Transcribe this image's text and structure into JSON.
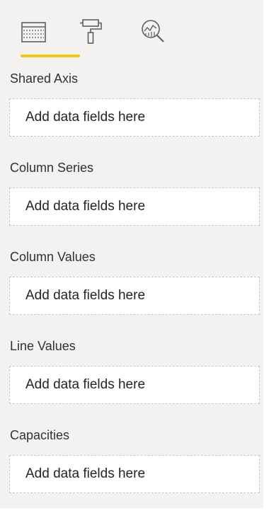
{
  "tabs": [
    {
      "id": "fields",
      "icon": "fields-table-icon",
      "active": true
    },
    {
      "id": "format",
      "icon": "paint-roller-icon",
      "active": false
    },
    {
      "id": "analytics",
      "icon": "analytics-magnifier-icon",
      "active": false
    }
  ],
  "colors": {
    "accent": "#f2c811",
    "pane_background": "#f3f2f1",
    "drop_zone_border": "#c8c6c4",
    "icon": "#605e5c"
  },
  "wells": [
    {
      "label": "Shared Axis",
      "placeholder": "Add data fields here"
    },
    {
      "label": "Column Series",
      "placeholder": "Add data fields here"
    },
    {
      "label": "Column Values",
      "placeholder": "Add data fields here"
    },
    {
      "label": "Line Values",
      "placeholder": "Add data fields here"
    },
    {
      "label": "Capacities",
      "placeholder": "Add data fields here"
    }
  ]
}
